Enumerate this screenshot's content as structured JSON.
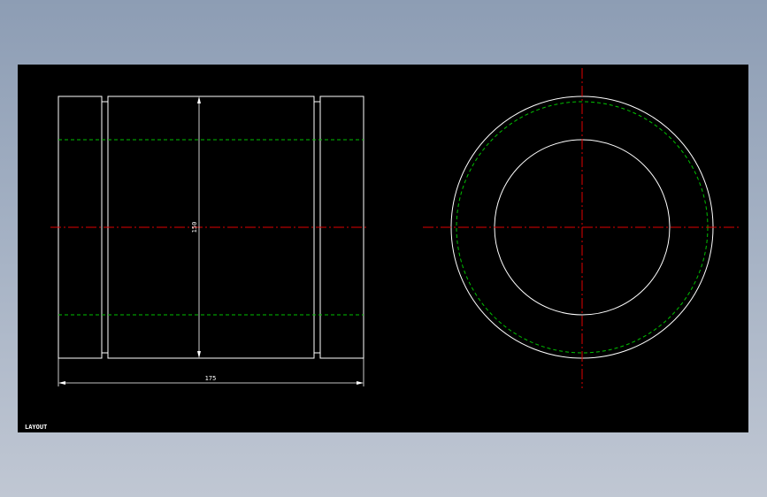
{
  "drawing": {
    "dimension_height": "150",
    "dimension_width": "175",
    "layout_tab": "LAYOUT"
  },
  "colors": {
    "background": "#000000",
    "outline": "#ffffff",
    "hidden_line": "#00c000",
    "center_line": "#e00000"
  }
}
